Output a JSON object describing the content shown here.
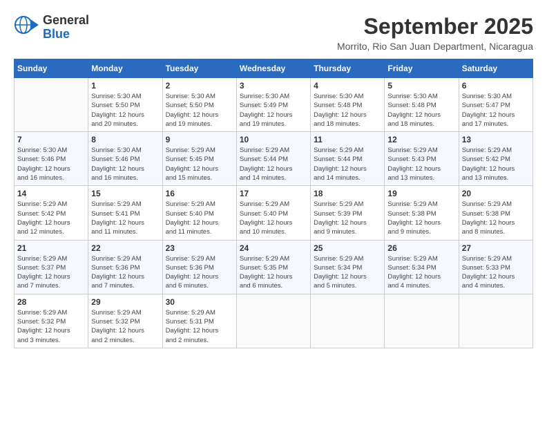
{
  "logo": {
    "general": "General",
    "blue": "Blue"
  },
  "title": "September 2025",
  "location": "Morrito, Rio San Juan Department, Nicaragua",
  "days_of_week": [
    "Sunday",
    "Monday",
    "Tuesday",
    "Wednesday",
    "Thursday",
    "Friday",
    "Saturday"
  ],
  "weeks": [
    [
      {
        "num": "",
        "info": ""
      },
      {
        "num": "1",
        "info": "Sunrise: 5:30 AM\nSunset: 5:50 PM\nDaylight: 12 hours\nand 20 minutes."
      },
      {
        "num": "2",
        "info": "Sunrise: 5:30 AM\nSunset: 5:50 PM\nDaylight: 12 hours\nand 19 minutes."
      },
      {
        "num": "3",
        "info": "Sunrise: 5:30 AM\nSunset: 5:49 PM\nDaylight: 12 hours\nand 19 minutes."
      },
      {
        "num": "4",
        "info": "Sunrise: 5:30 AM\nSunset: 5:48 PM\nDaylight: 12 hours\nand 18 minutes."
      },
      {
        "num": "5",
        "info": "Sunrise: 5:30 AM\nSunset: 5:48 PM\nDaylight: 12 hours\nand 18 minutes."
      },
      {
        "num": "6",
        "info": "Sunrise: 5:30 AM\nSunset: 5:47 PM\nDaylight: 12 hours\nand 17 minutes."
      }
    ],
    [
      {
        "num": "7",
        "info": "Sunrise: 5:30 AM\nSunset: 5:46 PM\nDaylight: 12 hours\nand 16 minutes."
      },
      {
        "num": "8",
        "info": "Sunrise: 5:30 AM\nSunset: 5:46 PM\nDaylight: 12 hours\nand 16 minutes."
      },
      {
        "num": "9",
        "info": "Sunrise: 5:29 AM\nSunset: 5:45 PM\nDaylight: 12 hours\nand 15 minutes."
      },
      {
        "num": "10",
        "info": "Sunrise: 5:29 AM\nSunset: 5:44 PM\nDaylight: 12 hours\nand 14 minutes."
      },
      {
        "num": "11",
        "info": "Sunrise: 5:29 AM\nSunset: 5:44 PM\nDaylight: 12 hours\nand 14 minutes."
      },
      {
        "num": "12",
        "info": "Sunrise: 5:29 AM\nSunset: 5:43 PM\nDaylight: 12 hours\nand 13 minutes."
      },
      {
        "num": "13",
        "info": "Sunrise: 5:29 AM\nSunset: 5:42 PM\nDaylight: 12 hours\nand 13 minutes."
      }
    ],
    [
      {
        "num": "14",
        "info": "Sunrise: 5:29 AM\nSunset: 5:42 PM\nDaylight: 12 hours\nand 12 minutes."
      },
      {
        "num": "15",
        "info": "Sunrise: 5:29 AM\nSunset: 5:41 PM\nDaylight: 12 hours\nand 11 minutes."
      },
      {
        "num": "16",
        "info": "Sunrise: 5:29 AM\nSunset: 5:40 PM\nDaylight: 12 hours\nand 11 minutes."
      },
      {
        "num": "17",
        "info": "Sunrise: 5:29 AM\nSunset: 5:40 PM\nDaylight: 12 hours\nand 10 minutes."
      },
      {
        "num": "18",
        "info": "Sunrise: 5:29 AM\nSunset: 5:39 PM\nDaylight: 12 hours\nand 9 minutes."
      },
      {
        "num": "19",
        "info": "Sunrise: 5:29 AM\nSunset: 5:38 PM\nDaylight: 12 hours\nand 9 minutes."
      },
      {
        "num": "20",
        "info": "Sunrise: 5:29 AM\nSunset: 5:38 PM\nDaylight: 12 hours\nand 8 minutes."
      }
    ],
    [
      {
        "num": "21",
        "info": "Sunrise: 5:29 AM\nSunset: 5:37 PM\nDaylight: 12 hours\nand 7 minutes."
      },
      {
        "num": "22",
        "info": "Sunrise: 5:29 AM\nSunset: 5:36 PM\nDaylight: 12 hours\nand 7 minutes."
      },
      {
        "num": "23",
        "info": "Sunrise: 5:29 AM\nSunset: 5:36 PM\nDaylight: 12 hours\nand 6 minutes."
      },
      {
        "num": "24",
        "info": "Sunrise: 5:29 AM\nSunset: 5:35 PM\nDaylight: 12 hours\nand 6 minutes."
      },
      {
        "num": "25",
        "info": "Sunrise: 5:29 AM\nSunset: 5:34 PM\nDaylight: 12 hours\nand 5 minutes."
      },
      {
        "num": "26",
        "info": "Sunrise: 5:29 AM\nSunset: 5:34 PM\nDaylight: 12 hours\nand 4 minutes."
      },
      {
        "num": "27",
        "info": "Sunrise: 5:29 AM\nSunset: 5:33 PM\nDaylight: 12 hours\nand 4 minutes."
      }
    ],
    [
      {
        "num": "28",
        "info": "Sunrise: 5:29 AM\nSunset: 5:32 PM\nDaylight: 12 hours\nand 3 minutes."
      },
      {
        "num": "29",
        "info": "Sunrise: 5:29 AM\nSunset: 5:32 PM\nDaylight: 12 hours\nand 2 minutes."
      },
      {
        "num": "30",
        "info": "Sunrise: 5:29 AM\nSunset: 5:31 PM\nDaylight: 12 hours\nand 2 minutes."
      },
      {
        "num": "",
        "info": ""
      },
      {
        "num": "",
        "info": ""
      },
      {
        "num": "",
        "info": ""
      },
      {
        "num": "",
        "info": ""
      }
    ]
  ]
}
